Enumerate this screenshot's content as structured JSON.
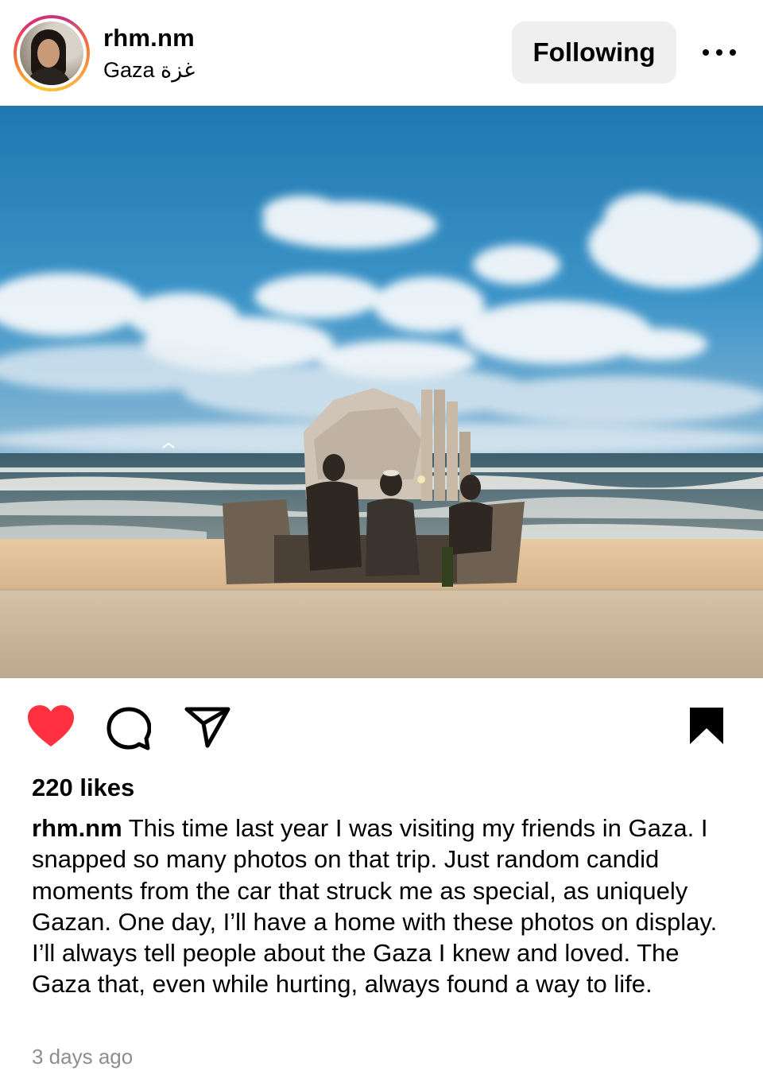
{
  "post": {
    "username": "rhm.nm",
    "location": "Gaza غزة",
    "follow_label": "Following",
    "photo_alt": "Beach scene",
    "likes_label": "220 likes",
    "caption_user": "rhm.nm",
    "caption_text": " This time last year I was visiting my friends in Gaza. I snapped so many photos on that trip. Just random candid moments from the car that struck me as special, as uniquely Gazan. One day, I’ll have a home with these photos on display. I’ll always tell people about the Gaza I knew and loved. The Gaza that, even while hurting, always found a way to life.",
    "timestamp": "3 days ago"
  },
  "icons": {
    "more": "more-icon",
    "like": "heart-icon",
    "comment": "comment-icon",
    "share": "share-icon",
    "save": "bookmark-icon"
  },
  "colors": {
    "like_active": "#ff3040",
    "button_bg": "#efefef",
    "muted_text": "#8e8e8e"
  }
}
